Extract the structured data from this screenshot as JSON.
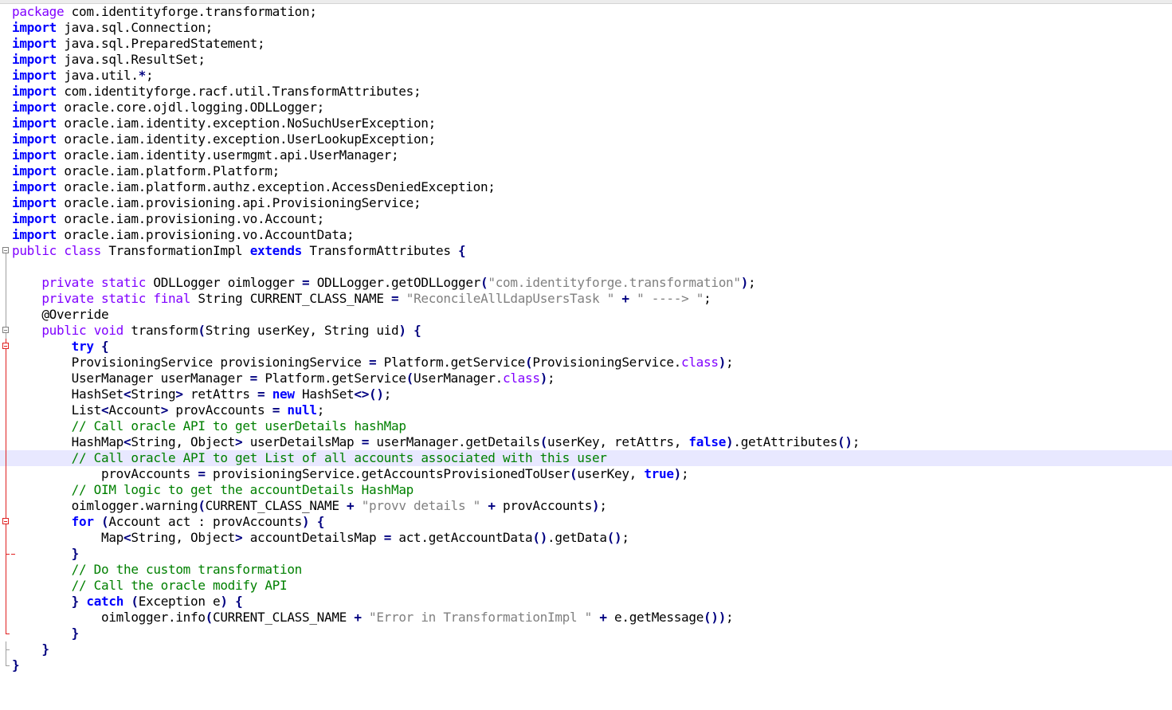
{
  "editor": {
    "current_line": 28,
    "lines": [
      {
        "fold": "none",
        "tokens": [
          [
            "mod",
            "package"
          ],
          [
            "",
            " com.identityforge.transformation;"
          ]
        ]
      },
      {
        "fold": "none",
        "tokens": [
          [
            "kw",
            "import"
          ],
          [
            "",
            " java.sql.Connection;"
          ]
        ]
      },
      {
        "fold": "none",
        "tokens": [
          [
            "kw",
            "import"
          ],
          [
            "",
            " java.sql.PreparedStatement;"
          ]
        ]
      },
      {
        "fold": "none",
        "tokens": [
          [
            "kw",
            "import"
          ],
          [
            "",
            " java.sql.ResultSet;"
          ]
        ]
      },
      {
        "fold": "none",
        "tokens": [
          [
            "kw",
            "import"
          ],
          [
            "",
            " java.util."
          ],
          [
            "op",
            "*"
          ],
          [
            "",
            ";"
          ]
        ]
      },
      {
        "fold": "none",
        "tokens": [
          [
            "kw",
            "import"
          ],
          [
            "",
            " com.identityforge.racf.util.TransformAttributes;"
          ]
        ]
      },
      {
        "fold": "none",
        "tokens": [
          [
            "kw",
            "import"
          ],
          [
            "",
            " oracle.core.ojdl.logging.ODLLogger;"
          ]
        ]
      },
      {
        "fold": "none",
        "tokens": [
          [
            "kw",
            "import"
          ],
          [
            "",
            " oracle.iam.identity.exception.NoSuchUserException;"
          ]
        ]
      },
      {
        "fold": "none",
        "tokens": [
          [
            "kw",
            "import"
          ],
          [
            "",
            " oracle.iam.identity.exception.UserLookupException;"
          ]
        ]
      },
      {
        "fold": "none",
        "tokens": [
          [
            "kw",
            "import"
          ],
          [
            "",
            " oracle.iam.identity.usermgmt.api.UserManager;"
          ]
        ]
      },
      {
        "fold": "none",
        "tokens": [
          [
            "kw",
            "import"
          ],
          [
            "",
            " oracle.iam.platform.Platform;"
          ]
        ]
      },
      {
        "fold": "none",
        "tokens": [
          [
            "kw",
            "import"
          ],
          [
            "",
            " oracle.iam.platform.authz.exception.AccessDeniedException;"
          ]
        ]
      },
      {
        "fold": "none",
        "tokens": [
          [
            "kw",
            "import"
          ],
          [
            "",
            " oracle.iam.provisioning.api.ProvisioningService;"
          ]
        ]
      },
      {
        "fold": "none",
        "tokens": [
          [
            "kw",
            "import"
          ],
          [
            "",
            " oracle.iam.provisioning.vo.Account;"
          ]
        ]
      },
      {
        "fold": "none",
        "tokens": [
          [
            "kw",
            "import"
          ],
          [
            "",
            " oracle.iam.provisioning.vo.AccountData;"
          ]
        ]
      },
      {
        "fold": "open",
        "tokens": [
          [
            "mod",
            "public"
          ],
          [
            "",
            " "
          ],
          [
            "mod",
            "class"
          ],
          [
            "",
            " TransformationImpl "
          ],
          [
            "kw",
            "extends"
          ],
          [
            "",
            " TransformAttributes "
          ],
          [
            "op",
            "{"
          ]
        ]
      },
      {
        "fold": "line",
        "tokens": [
          [
            "",
            ""
          ]
        ]
      },
      {
        "fold": "line",
        "tokens": [
          [
            "",
            "    "
          ],
          [
            "mod",
            "private"
          ],
          [
            "",
            " "
          ],
          [
            "mod",
            "static"
          ],
          [
            "",
            " ODLLogger oimlogger "
          ],
          [
            "op",
            "="
          ],
          [
            "",
            " ODLLogger.getODLLogger"
          ],
          [
            "op",
            "("
          ],
          [
            "str",
            "\"com.identityforge.transformation\""
          ],
          [
            "op",
            ")"
          ],
          [
            "",
            ";"
          ]
        ]
      },
      {
        "fold": "line",
        "tokens": [
          [
            "",
            "    "
          ],
          [
            "mod",
            "private"
          ],
          [
            "",
            " "
          ],
          [
            "mod",
            "static"
          ],
          [
            "",
            " "
          ],
          [
            "mod",
            "final"
          ],
          [
            "",
            " String CURRENT_CLASS_NAME "
          ],
          [
            "op",
            "="
          ],
          [
            "",
            " "
          ],
          [
            "str",
            "\"ReconcileAllLdapUsersTask \""
          ],
          [
            "",
            " "
          ],
          [
            "op",
            "+"
          ],
          [
            "",
            " "
          ],
          [
            "str",
            "\" ----> \""
          ],
          [
            "",
            ";"
          ]
        ]
      },
      {
        "fold": "line",
        "tokens": [
          [
            "",
            "    "
          ],
          [
            "ann",
            "@Override"
          ]
        ]
      },
      {
        "fold": "open",
        "tokens": [
          [
            "",
            "    "
          ],
          [
            "mod",
            "public"
          ],
          [
            "",
            " "
          ],
          [
            "mod",
            "void"
          ],
          [
            "",
            " transform"
          ],
          [
            "op",
            "("
          ],
          [
            "",
            "String userKey, String uid"
          ],
          [
            "op",
            ")"
          ],
          [
            "",
            " "
          ],
          [
            "op",
            "{"
          ]
        ]
      },
      {
        "fold": "open-red",
        "tokens": [
          [
            "",
            "        "
          ],
          [
            "kw",
            "try"
          ],
          [
            "",
            " "
          ],
          [
            "op",
            "{"
          ]
        ]
      },
      {
        "fold": "red",
        "tokens": [
          [
            "",
            "        ProvisioningService provisioningService "
          ],
          [
            "op",
            "="
          ],
          [
            "",
            " Platform.getService"
          ],
          [
            "op",
            "("
          ],
          [
            "",
            "ProvisioningService."
          ],
          [
            "mod",
            "class"
          ],
          [
            "op",
            ")"
          ],
          [
            "",
            ";"
          ]
        ]
      },
      {
        "fold": "red",
        "tokens": [
          [
            "",
            "        UserManager userManager "
          ],
          [
            "op",
            "="
          ],
          [
            "",
            " Platform.getService"
          ],
          [
            "op",
            "("
          ],
          [
            "",
            "UserManager."
          ],
          [
            "mod",
            "class"
          ],
          [
            "op",
            ")"
          ],
          [
            "",
            ";"
          ]
        ]
      },
      {
        "fold": "red",
        "tokens": [
          [
            "",
            "        HashSet"
          ],
          [
            "op",
            "<"
          ],
          [
            "",
            "String"
          ],
          [
            "op",
            ">"
          ],
          [
            "",
            " retAttrs "
          ],
          [
            "op",
            "="
          ],
          [
            "",
            " "
          ],
          [
            "kw",
            "new"
          ],
          [
            "",
            " HashSet"
          ],
          [
            "op",
            "<>()"
          ],
          [
            "",
            ";"
          ]
        ]
      },
      {
        "fold": "red",
        "tokens": [
          [
            "",
            "        List"
          ],
          [
            "op",
            "<"
          ],
          [
            "",
            "Account"
          ],
          [
            "op",
            ">"
          ],
          [
            "",
            " provAccounts "
          ],
          [
            "op",
            "="
          ],
          [
            "",
            " "
          ],
          [
            "kw",
            "null"
          ],
          [
            "",
            ";"
          ]
        ]
      },
      {
        "fold": "red",
        "tokens": [
          [
            "",
            "        "
          ],
          [
            "com",
            "// Call oracle API to get userDetails hashMap"
          ]
        ]
      },
      {
        "fold": "red",
        "tokens": [
          [
            "",
            "        HashMap"
          ],
          [
            "op",
            "<"
          ],
          [
            "",
            "String, Object"
          ],
          [
            "op",
            ">"
          ],
          [
            "",
            " userDetailsMap "
          ],
          [
            "op",
            "="
          ],
          [
            "",
            " userManager.getDetails"
          ],
          [
            "op",
            "("
          ],
          [
            "",
            "userKey, retAttrs, "
          ],
          [
            "kw",
            "false"
          ],
          [
            "op",
            ")"
          ],
          [
            "",
            ".getAttributes"
          ],
          [
            "op",
            "()"
          ],
          [
            "",
            ";"
          ]
        ]
      },
      {
        "fold": "red",
        "tokens": [
          [
            "",
            "        "
          ],
          [
            "com",
            "// Call oracle API to get List of all accounts associated with this user"
          ]
        ]
      },
      {
        "fold": "red",
        "tokens": [
          [
            "",
            "            provAccounts "
          ],
          [
            "op",
            "="
          ],
          [
            "",
            " provisioningService.getAccountsProvisionedToUser"
          ],
          [
            "op",
            "("
          ],
          [
            "",
            "userKey, "
          ],
          [
            "kw",
            "true"
          ],
          [
            "op",
            ")"
          ],
          [
            "",
            ";"
          ]
        ]
      },
      {
        "fold": "red",
        "tokens": [
          [
            "",
            "        "
          ],
          [
            "com",
            "// OIM logic to get the accountDetails HashMap"
          ]
        ]
      },
      {
        "fold": "red",
        "tokens": [
          [
            "",
            "        oimlogger.warning"
          ],
          [
            "op",
            "("
          ],
          [
            "",
            "CURRENT_CLASS_NAME "
          ],
          [
            "op",
            "+"
          ],
          [
            "",
            " "
          ],
          [
            "str",
            "\"provv details \""
          ],
          [
            "",
            " "
          ],
          [
            "op",
            "+"
          ],
          [
            "",
            " provAccounts"
          ],
          [
            "op",
            ")"
          ],
          [
            "",
            ";"
          ]
        ]
      },
      {
        "fold": "open-red",
        "tokens": [
          [
            "",
            "        "
          ],
          [
            "kw",
            "for"
          ],
          [
            "",
            " "
          ],
          [
            "op",
            "("
          ],
          [
            "",
            "Account act : provAccounts"
          ],
          [
            "op",
            ")"
          ],
          [
            "",
            " "
          ],
          [
            "op",
            "{"
          ]
        ]
      },
      {
        "fold": "red",
        "tokens": [
          [
            "",
            "            Map"
          ],
          [
            "op",
            "<"
          ],
          [
            "",
            "String, Object"
          ],
          [
            "op",
            ">"
          ],
          [
            "",
            " accountDetailsMap "
          ],
          [
            "op",
            "="
          ],
          [
            "",
            " act.getAccountData"
          ],
          [
            "op",
            "()"
          ],
          [
            "",
            ".getData"
          ],
          [
            "op",
            "()"
          ],
          [
            "",
            ";"
          ]
        ]
      },
      {
        "fold": "tee-red",
        "tokens": [
          [
            "",
            "        "
          ],
          [
            "op",
            "}"
          ]
        ]
      },
      {
        "fold": "red",
        "tokens": [
          [
            "",
            "        "
          ],
          [
            "com",
            "// Do the custom transformation"
          ]
        ]
      },
      {
        "fold": "red",
        "tokens": [
          [
            "",
            "        "
          ],
          [
            "com",
            "// Call the oracle modify API"
          ]
        ]
      },
      {
        "fold": "red",
        "tokens": [
          [
            "",
            "        "
          ],
          [
            "op",
            "}"
          ],
          [
            "",
            " "
          ],
          [
            "kw",
            "catch"
          ],
          [
            "",
            " "
          ],
          [
            "op",
            "("
          ],
          [
            "",
            "Exception e"
          ],
          [
            "op",
            ")"
          ],
          [
            "",
            " "
          ],
          [
            "op",
            "{"
          ]
        ]
      },
      {
        "fold": "red",
        "tokens": [
          [
            "",
            "            oimlogger.info"
          ],
          [
            "op",
            "("
          ],
          [
            "",
            "CURRENT_CLASS_NAME "
          ],
          [
            "op",
            "+"
          ],
          [
            "",
            " "
          ],
          [
            "str",
            "\"Error in TransformationImpl \""
          ],
          [
            "",
            " "
          ],
          [
            "op",
            "+"
          ],
          [
            "",
            " e.getMessage"
          ],
          [
            "op",
            "())"
          ],
          [
            "",
            ";"
          ]
        ]
      },
      {
        "fold": "end-red",
        "tokens": [
          [
            "",
            "        "
          ],
          [
            "op",
            "}"
          ]
        ]
      },
      {
        "fold": "end",
        "tokens": [
          [
            "",
            "    "
          ],
          [
            "op",
            "}"
          ]
        ]
      },
      {
        "fold": "end",
        "tokens": [
          [
            "op",
            "}"
          ]
        ]
      }
    ]
  }
}
